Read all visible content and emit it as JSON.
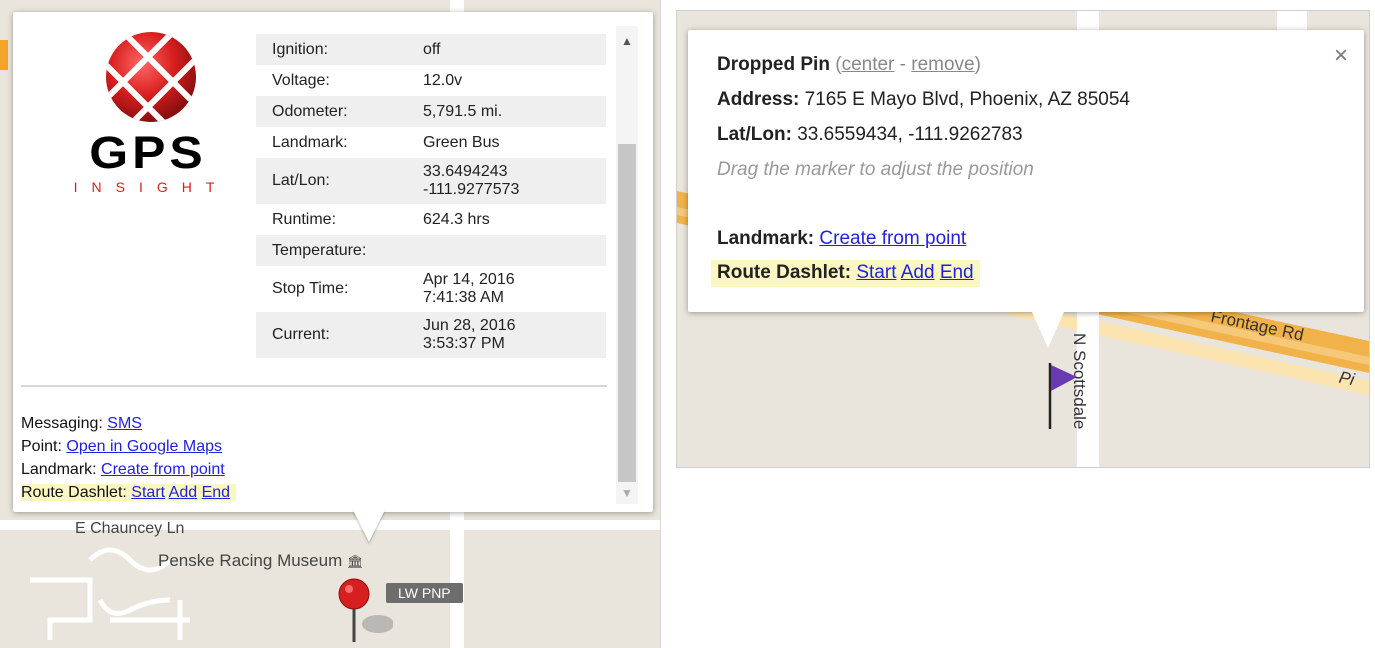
{
  "left": {
    "logo": {
      "main": "GPS",
      "sub": "INSIGHT"
    },
    "rows": [
      {
        "key": "Ignition:",
        "val": "off"
      },
      {
        "key": "Voltage:",
        "val": "12.0v"
      },
      {
        "key": "Odometer:",
        "val": "5,791.5 mi."
      },
      {
        "key": "Landmark:",
        "val": "Green Bus"
      },
      {
        "key": "Lat/Lon:",
        "val": "33.6494243",
        "val2": "-111.9277573"
      },
      {
        "key": "Runtime:",
        "val": "624.3 hrs"
      },
      {
        "key": "Temperature:",
        "val": ""
      },
      {
        "key": "Stop Time:",
        "val": "Apr 14, 2016",
        "val2": "7:41:38 AM"
      },
      {
        "key": "Current:",
        "val": "Jun 28, 2016",
        "val2": "3:53:37 PM"
      }
    ],
    "links": {
      "messaging_label": "Messaging:",
      "messaging_link": "SMS",
      "point_label": "Point:",
      "point_link": "Open in Google Maps",
      "landmark_label": "Landmark:",
      "landmark_link": "Create from point",
      "route_label": "Route Dashlet:",
      "start": "Start",
      "add": "Add",
      "end": "End"
    },
    "map": {
      "street": "E Chauncey Ln",
      "poi": "Penske Racing Museum",
      "marker_label": "LW PNP"
    }
  },
  "right": {
    "title": "Dropped Pin",
    "center": "center",
    "dash": "-",
    "remove": "remove",
    "address_label": "Address:",
    "address": "7165 E Mayo Blvd, Phoenix, AZ 85054",
    "latlon_label": "Lat/Lon:",
    "latlon": "33.6559434, -111.9262783",
    "hint": "Drag the marker to adjust the position",
    "landmark_label": "Landmark:",
    "landmark_link": "Create from point",
    "route_label": "Route Dashlet:",
    "start": "Start",
    "add": "Add",
    "end": "End",
    "close": "×",
    "map": {
      "road1": "Frontage Rd",
      "road2": "Pi",
      "road3": "N Scottsdale"
    }
  },
  "colors": {
    "link": "#2222dd",
    "highlight": "#fbf7c2",
    "marker_red": "#d81f1f",
    "flag_purple": "#6a3ab0"
  }
}
